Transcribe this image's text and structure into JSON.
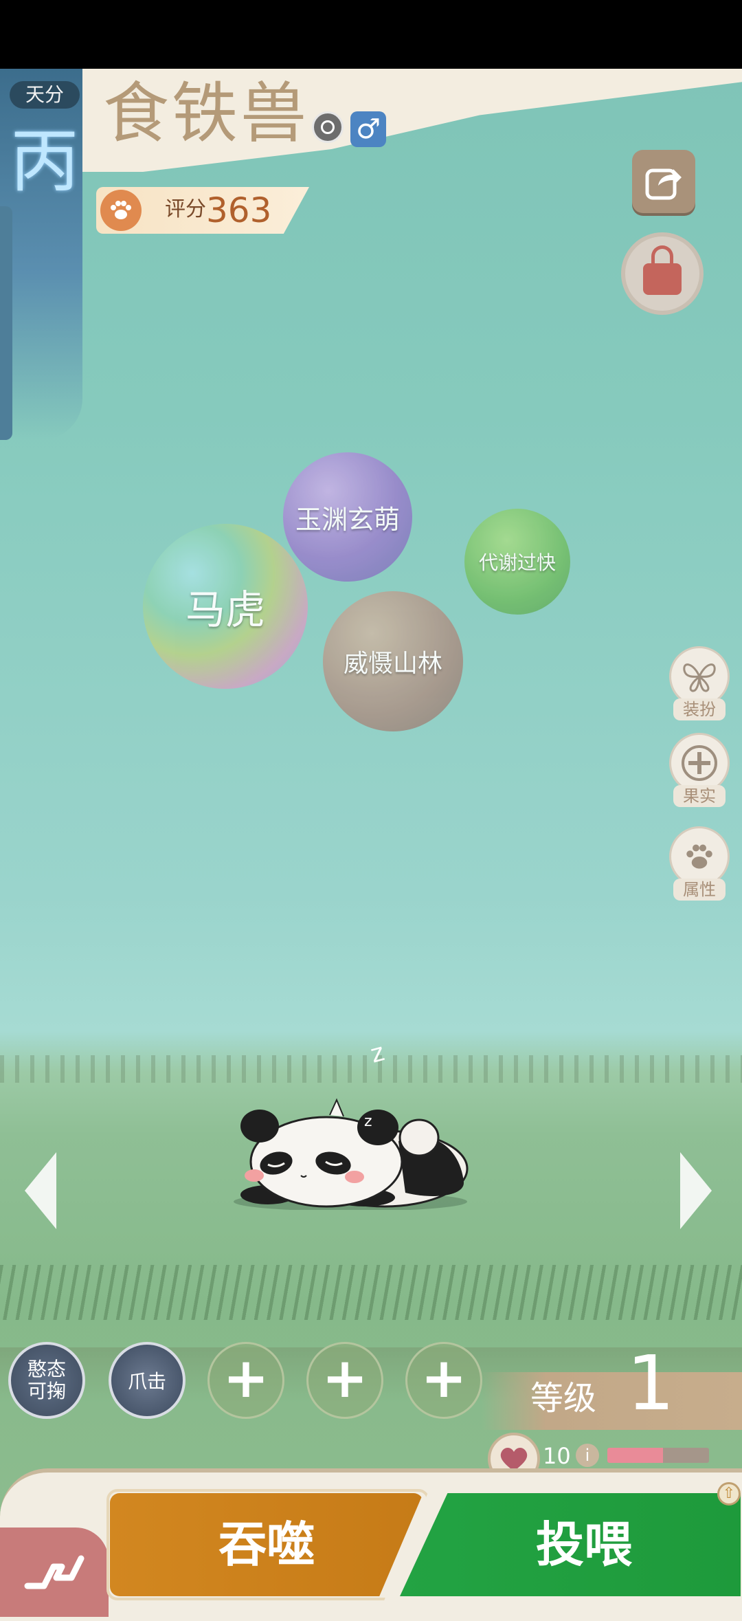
{
  "header": {
    "grade_tag": "天分",
    "grade": "丙",
    "beast_name": "食铁兽",
    "gender_symbol": "♂",
    "score_label": "评分",
    "score_value": "363"
  },
  "traits": [
    {
      "label": "玉渊玄萌",
      "color": "#9a86cc"
    },
    {
      "label": "代谢过快",
      "color": "#74bf6b"
    },
    {
      "label": "马虎",
      "color": "#b7d28a"
    },
    {
      "label": "威慑山林",
      "color": "#a9968a"
    }
  ],
  "side_menu": [
    {
      "label": "装扮",
      "icon": "butterfly-icon"
    },
    {
      "label": "果实",
      "icon": "plus-icon"
    },
    {
      "label": "属性",
      "icon": "paw-icon"
    }
  ],
  "skills": {
    "rage": "憨态可掬",
    "claw": "爪击",
    "empty_slots": [
      "+",
      "+",
      "+"
    ]
  },
  "level": {
    "label": "等级",
    "value": "1"
  },
  "hp": {
    "value": "10",
    "info": "i",
    "fill_fraction": 0.55
  },
  "sleep_mark": "z",
  "actions": {
    "devour": "吞噬",
    "feed": "投喂"
  },
  "colors": {
    "devour": "#d28720",
    "feed": "#23a343",
    "grade_ribbon": "#3c6d8c"
  }
}
